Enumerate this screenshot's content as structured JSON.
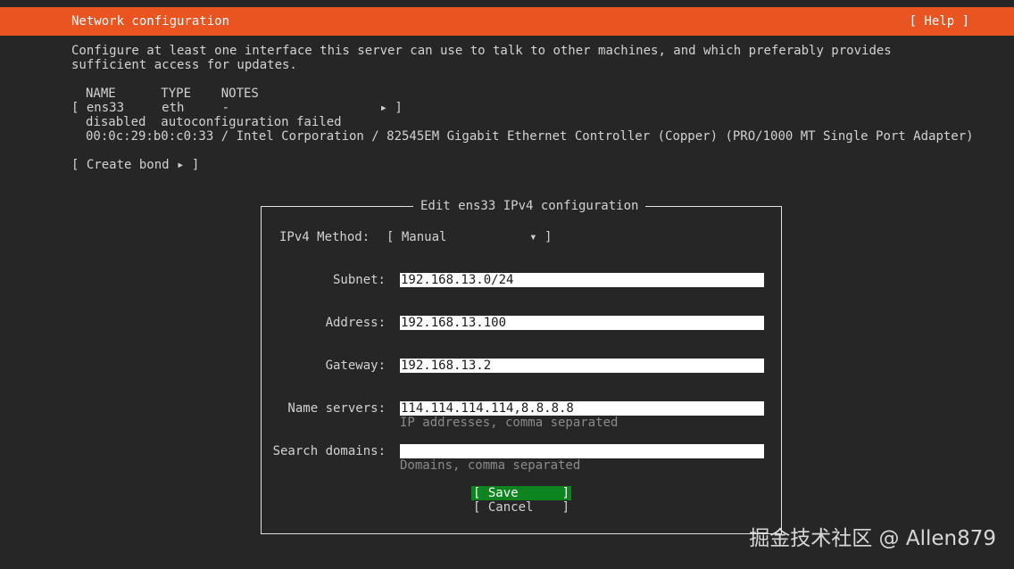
{
  "header": {
    "title": "Network configuration",
    "help_label": "[ Help ]",
    "accent_color": "#e95420"
  },
  "description": "Configure at least one interface this server can use to talk to other machines, and which preferably provides sufficient access for updates.",
  "interfaces": {
    "columns": "NAME      TYPE    NOTES",
    "row": "[ ens33     eth     -                    ▸ ]",
    "status": "disabled  autoconfiguration failed",
    "info": "00:0c:29:b0:c0:33 / Intel Corporation / 82545EM Gigabit Ethernet Controller (Copper) (PRO/1000 MT Single Port Adapter)"
  },
  "create_bond_label": "[ Create bond ▸ ]",
  "dialog": {
    "title": "Edit ens33 IPv4 configuration",
    "method_label": "IPv4 Method:",
    "method_value": "[ Manual           ▾ ]",
    "subnet_label": "Subnet:",
    "subnet_value": "192.168.13.0/24",
    "address_label": "Address:",
    "address_value": "192.168.13.100",
    "gateway_label": "Gateway:",
    "gateway_value": "192.168.13.2",
    "nameservers_label": "Name servers:",
    "nameservers_value": "114.114.114.114,8.8.8.8",
    "nameservers_hint": "IP addresses, comma separated",
    "searchdomains_label": "Search domains:",
    "searchdomains_value": "",
    "searchdomains_hint": "Domains, comma separated",
    "save_label": "Save",
    "cancel_label": "Cancel",
    "save_color": "#0e8420"
  },
  "watermark": "掘金技术社区 @ Allen879"
}
